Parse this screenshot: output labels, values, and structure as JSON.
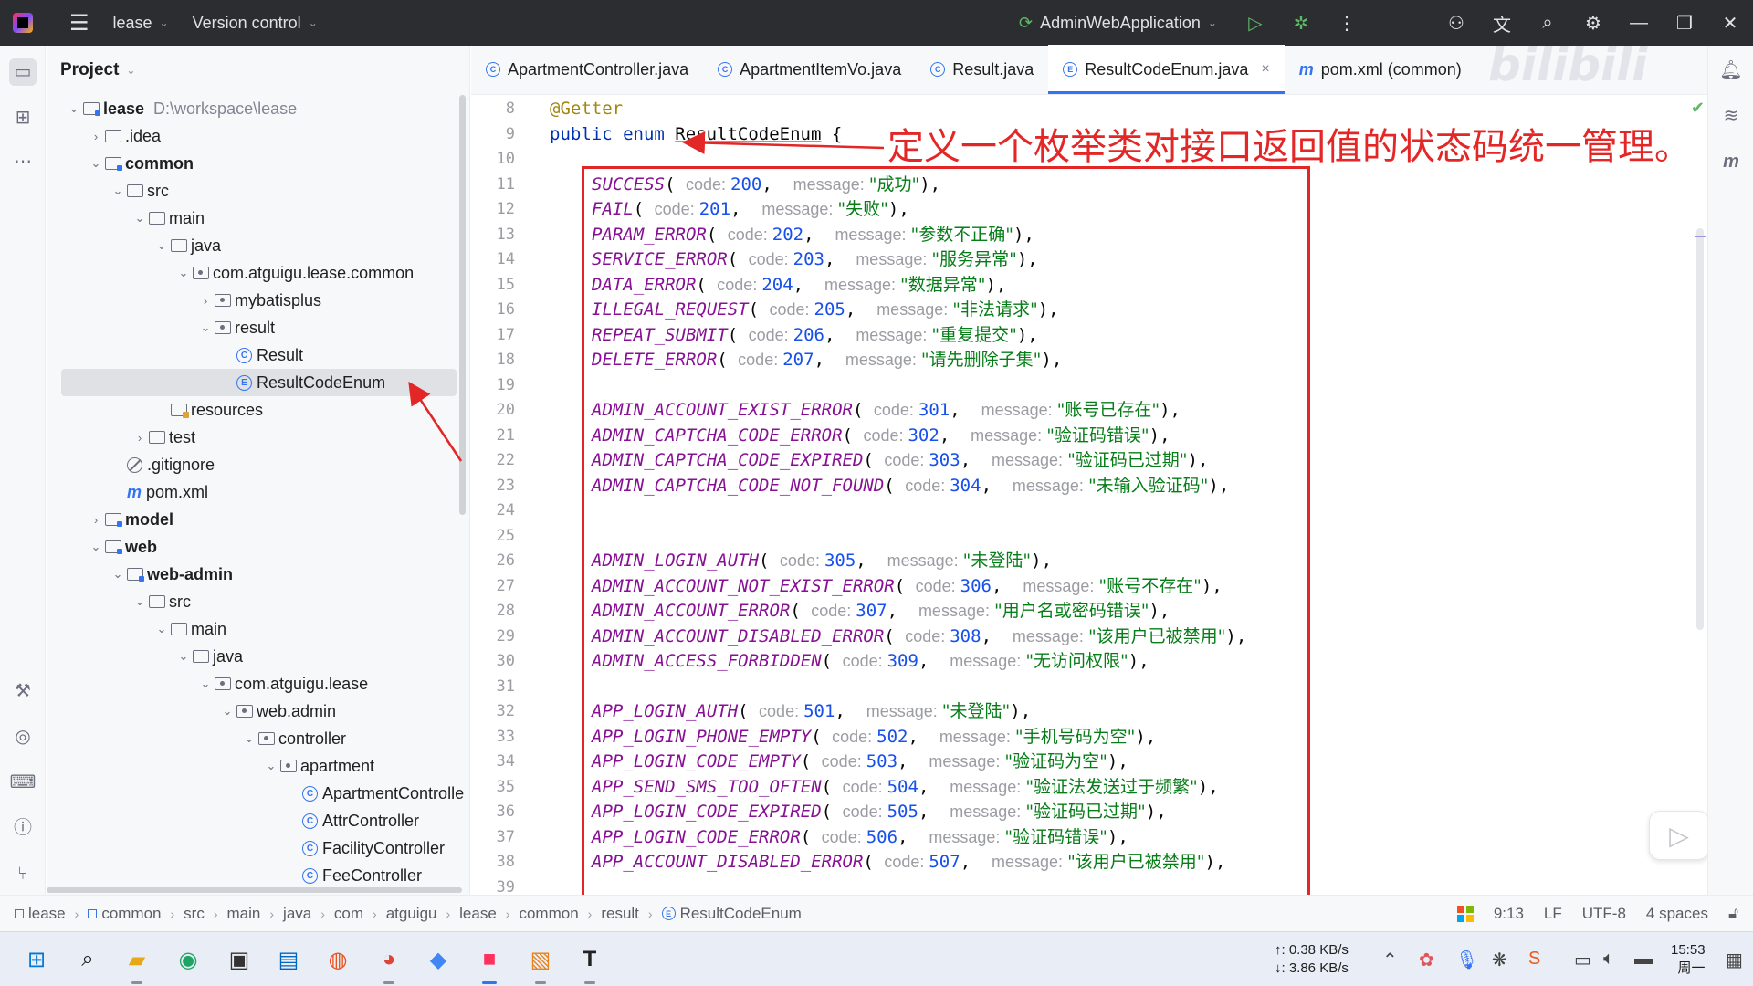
{
  "titlebar": {
    "project": "lease",
    "vcs": "Version control",
    "run_config": "AdminWebApplication"
  },
  "project_panel": {
    "title": "Project",
    "tree": [
      {
        "label": "lease",
        "path": "D:\\workspace\\lease",
        "depth": 0,
        "kind": "module",
        "arrow": "down",
        "bold": true
      },
      {
        "label": ".idea",
        "depth": 1,
        "kind": "folder",
        "arrow": "right"
      },
      {
        "label": "common",
        "depth": 1,
        "kind": "module",
        "arrow": "down",
        "bold": true
      },
      {
        "label": "src",
        "depth": 2,
        "kind": "folder",
        "arrow": "down"
      },
      {
        "label": "main",
        "depth": 3,
        "kind": "folder",
        "arrow": "down"
      },
      {
        "label": "java",
        "depth": 4,
        "kind": "folder",
        "arrow": "down"
      },
      {
        "label": "com.atguigu.lease.common",
        "depth": 5,
        "kind": "package",
        "arrow": "down"
      },
      {
        "label": "mybatisplus",
        "depth": 6,
        "kind": "package",
        "arrow": "right"
      },
      {
        "label": "result",
        "depth": 6,
        "kind": "package",
        "arrow": "down"
      },
      {
        "label": "Result",
        "depth": 7,
        "kind": "class",
        "badge": "C"
      },
      {
        "label": "ResultCodeEnum",
        "depth": 7,
        "kind": "class",
        "badge": "E",
        "selected": true
      },
      {
        "label": "resources",
        "depth": 4,
        "kind": "resources"
      },
      {
        "label": "test",
        "depth": 3,
        "kind": "folder",
        "arrow": "right"
      },
      {
        "label": ".gitignore",
        "depth": 2,
        "kind": "gitignore"
      },
      {
        "label": "pom.xml",
        "depth": 2,
        "kind": "maven"
      },
      {
        "label": "model",
        "depth": 1,
        "kind": "module",
        "arrow": "right",
        "bold": true
      },
      {
        "label": "web",
        "depth": 1,
        "kind": "module",
        "arrow": "down",
        "bold": true
      },
      {
        "label": "web-admin",
        "depth": 2,
        "kind": "module",
        "arrow": "down",
        "bold": true
      },
      {
        "label": "src",
        "depth": 3,
        "kind": "folder",
        "arrow": "down"
      },
      {
        "label": "main",
        "depth": 4,
        "kind": "folder",
        "arrow": "down"
      },
      {
        "label": "java",
        "depth": 5,
        "kind": "folder",
        "arrow": "down"
      },
      {
        "label": "com.atguigu.lease",
        "depth": 6,
        "kind": "package",
        "arrow": "down"
      },
      {
        "label": "web.admin",
        "depth": 7,
        "kind": "package",
        "arrow": "down"
      },
      {
        "label": "controller",
        "depth": 8,
        "kind": "package",
        "arrow": "down"
      },
      {
        "label": "apartment",
        "depth": 9,
        "kind": "package",
        "arrow": "down"
      },
      {
        "label": "ApartmentControlle",
        "depth": 10,
        "kind": "class",
        "badge": "C"
      },
      {
        "label": "AttrController",
        "depth": 10,
        "kind": "class",
        "badge": "C"
      },
      {
        "label": "FacilityController",
        "depth": 10,
        "kind": "class",
        "badge": "C"
      },
      {
        "label": "FeeController",
        "depth": 10,
        "kind": "class",
        "badge": "C"
      }
    ]
  },
  "tabs": [
    {
      "label": "ApartmentController.java",
      "badge": "C",
      "active": false
    },
    {
      "label": "ApartmentItemVo.java",
      "badge": "C",
      "active": false
    },
    {
      "label": "Result.java",
      "badge": "C",
      "active": false
    },
    {
      "label": "ResultCodeEnum.java",
      "badge": "E",
      "active": true,
      "close": "×"
    },
    {
      "label": "pom.xml (common)",
      "badge": "m",
      "active": false
    }
  ],
  "editor": {
    "header_lines": [
      {
        "n": "8",
        "annotation": "@Getter"
      },
      {
        "n": "9",
        "kw1": "public",
        "kw2": "enum",
        "name": "ResultCodeEnum",
        "brace": "{"
      },
      {
        "n": "10"
      }
    ],
    "enum_lines": [
      {
        "n": "11",
        "name": "SUCCESS",
        "code": "200",
        "message": "\"成功\""
      },
      {
        "n": "12",
        "name": "FAIL",
        "code": "201",
        "message": "\"失败\""
      },
      {
        "n": "13",
        "name": "PARAM_ERROR",
        "code": "202",
        "message": "\"参数不正确\""
      },
      {
        "n": "14",
        "name": "SERVICE_ERROR",
        "code": "203",
        "message": "\"服务异常\""
      },
      {
        "n": "15",
        "name": "DATA_ERROR",
        "code": "204",
        "message": "\"数据异常\""
      },
      {
        "n": "16",
        "name": "ILLEGAL_REQUEST",
        "code": "205",
        "message": "\"非法请求\""
      },
      {
        "n": "17",
        "name": "REPEAT_SUBMIT",
        "code": "206",
        "message": "\"重复提交\""
      },
      {
        "n": "18",
        "name": "DELETE_ERROR",
        "code": "207",
        "message": "\"请先删除子集\""
      },
      {
        "n": "19"
      },
      {
        "n": "20",
        "name": "ADMIN_ACCOUNT_EXIST_ERROR",
        "code": "301",
        "message": "\"账号已存在\""
      },
      {
        "n": "21",
        "name": "ADMIN_CAPTCHA_CODE_ERROR",
        "code": "302",
        "message": "\"验证码错误\""
      },
      {
        "n": "22",
        "name": "ADMIN_CAPTCHA_CODE_EXPIRED",
        "code": "303",
        "message": "\"验证码已过期\""
      },
      {
        "n": "23",
        "name": "ADMIN_CAPTCHA_CODE_NOT_FOUND",
        "code": "304",
        "message": "\"未输入验证码\""
      },
      {
        "n": "24"
      },
      {
        "n": "25"
      },
      {
        "n": "26",
        "name": "ADMIN_LOGIN_AUTH",
        "code": "305",
        "message": "\"未登陆\""
      },
      {
        "n": "27",
        "name": "ADMIN_ACCOUNT_NOT_EXIST_ERROR",
        "code": "306",
        "message": "\"账号不存在\""
      },
      {
        "n": "28",
        "name": "ADMIN_ACCOUNT_ERROR",
        "code": "307",
        "message": "\"用户名或密码错误\""
      },
      {
        "n": "29",
        "name": "ADMIN_ACCOUNT_DISABLED_ERROR",
        "code": "308",
        "message": "\"该用户已被禁用\""
      },
      {
        "n": "30",
        "name": "ADMIN_ACCESS_FORBIDDEN",
        "code": "309",
        "message": "\"无访问权限\""
      },
      {
        "n": "31"
      },
      {
        "n": "32",
        "name": "APP_LOGIN_AUTH",
        "code": "501",
        "message": "\"未登陆\""
      },
      {
        "n": "33",
        "name": "APP_LOGIN_PHONE_EMPTY",
        "code": "502",
        "message": "\"手机号码为空\""
      },
      {
        "n": "34",
        "name": "APP_LOGIN_CODE_EMPTY",
        "code": "503",
        "message": "\"验证码为空\""
      },
      {
        "n": "35",
        "name": "APP_SEND_SMS_TOO_OFTEN",
        "code": "504",
        "message": "\"验证法发送过于频繁\""
      },
      {
        "n": "36",
        "name": "APP_LOGIN_CODE_EXPIRED",
        "code": "505",
        "message": "\"验证码已过期\""
      },
      {
        "n": "37",
        "name": "APP_LOGIN_CODE_ERROR",
        "code": "506",
        "message": "\"验证码错误\""
      },
      {
        "n": "38",
        "name": "APP_ACCOUNT_DISABLED_ERROR",
        "code": "507",
        "message": "\"该用户已被禁用\""
      },
      {
        "n": "39"
      }
    ],
    "hint_code": "code:",
    "hint_message": "message:",
    "callout": "定义一个枚举类对接口返回值的状态码统一管理。"
  },
  "breadcrumb": [
    "lease",
    "common",
    "src",
    "main",
    "java",
    "com",
    "atguigu",
    "lease",
    "common",
    "result",
    "ResultCodeEnum"
  ],
  "status": {
    "position": "9:13",
    "line_sep": "LF",
    "encoding": "UTF-8",
    "indent": "4 spaces"
  },
  "taskbar": {
    "upload": "↑: 0.38 KB/s",
    "download": "↓: 3.86 KB/s",
    "time": "15:53",
    "day": "周一"
  },
  "colors": {
    "accent": "#3574f0",
    "annotation_red": "#e32626",
    "titlebar_bg": "#2b2d30"
  }
}
